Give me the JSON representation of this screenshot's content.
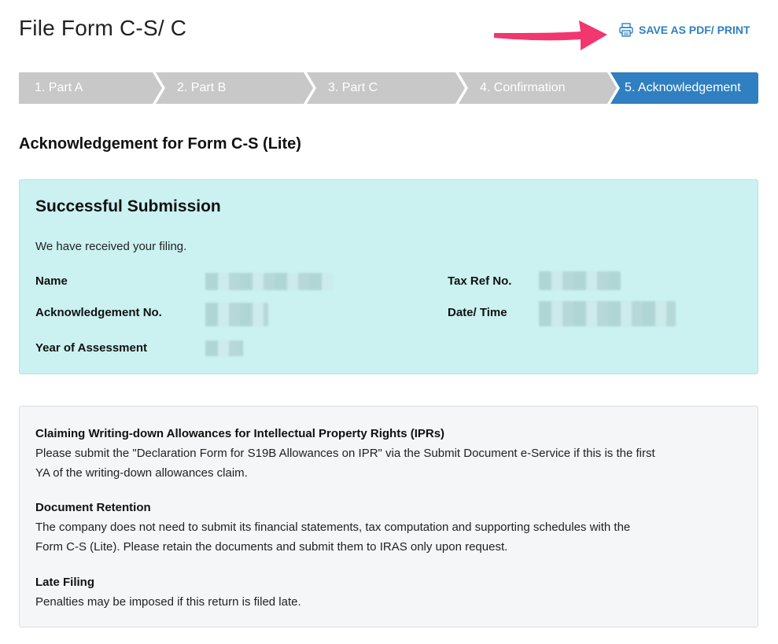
{
  "header": {
    "title": "File Form C-S/ C",
    "print_label": "SAVE AS PDF/ PRINT",
    "print_icon": "printer-icon",
    "annotation_arrow_color": "#f2366f"
  },
  "stepper": {
    "steps": [
      {
        "label": "1.  Part A",
        "state": "inactive"
      },
      {
        "label": "2.  Part B",
        "state": "inactive"
      },
      {
        "label": "3.  Part C",
        "state": "inactive"
      },
      {
        "label": "4.  Confirmation",
        "state": "inactive"
      },
      {
        "label": "5.  Acknowledgement",
        "state": "active"
      }
    ],
    "inactive_color": "#c8c8c8",
    "active_color": "#2f7fc1"
  },
  "main": {
    "heading": "Acknowledgement for Form C-S (Lite)",
    "success": {
      "title": "Successful Submission",
      "message": "We have received your filing.",
      "fields": {
        "name_label": "Name",
        "ack_label": "Acknowledgement No.",
        "ya_label": "Year of Assessment",
        "taxref_label": "Tax Ref No.",
        "datetime_label": "Date/ Time"
      },
      "background_color": "#cbf1f1"
    },
    "info": {
      "sections": [
        {
          "title": "Claiming Writing-down Allowances for Intellectual Property Rights (IPRs)",
          "lines": [
            "Please submit the \"Declaration Form for S19B Allowances on IPR\" via the Submit Document e-Service if this is the first",
            "YA of the writing-down allowances claim."
          ]
        },
        {
          "title": "Document Retention",
          "lines": [
            "The company does not need to submit its financial statements, tax computation and supporting schedules with the",
            "Form C-S (Lite). Please retain the documents and submit them to IRAS only upon request."
          ]
        },
        {
          "title": "Late Filing",
          "lines": [
            "Penalties may be imposed if this return is filed late."
          ]
        }
      ]
    }
  }
}
